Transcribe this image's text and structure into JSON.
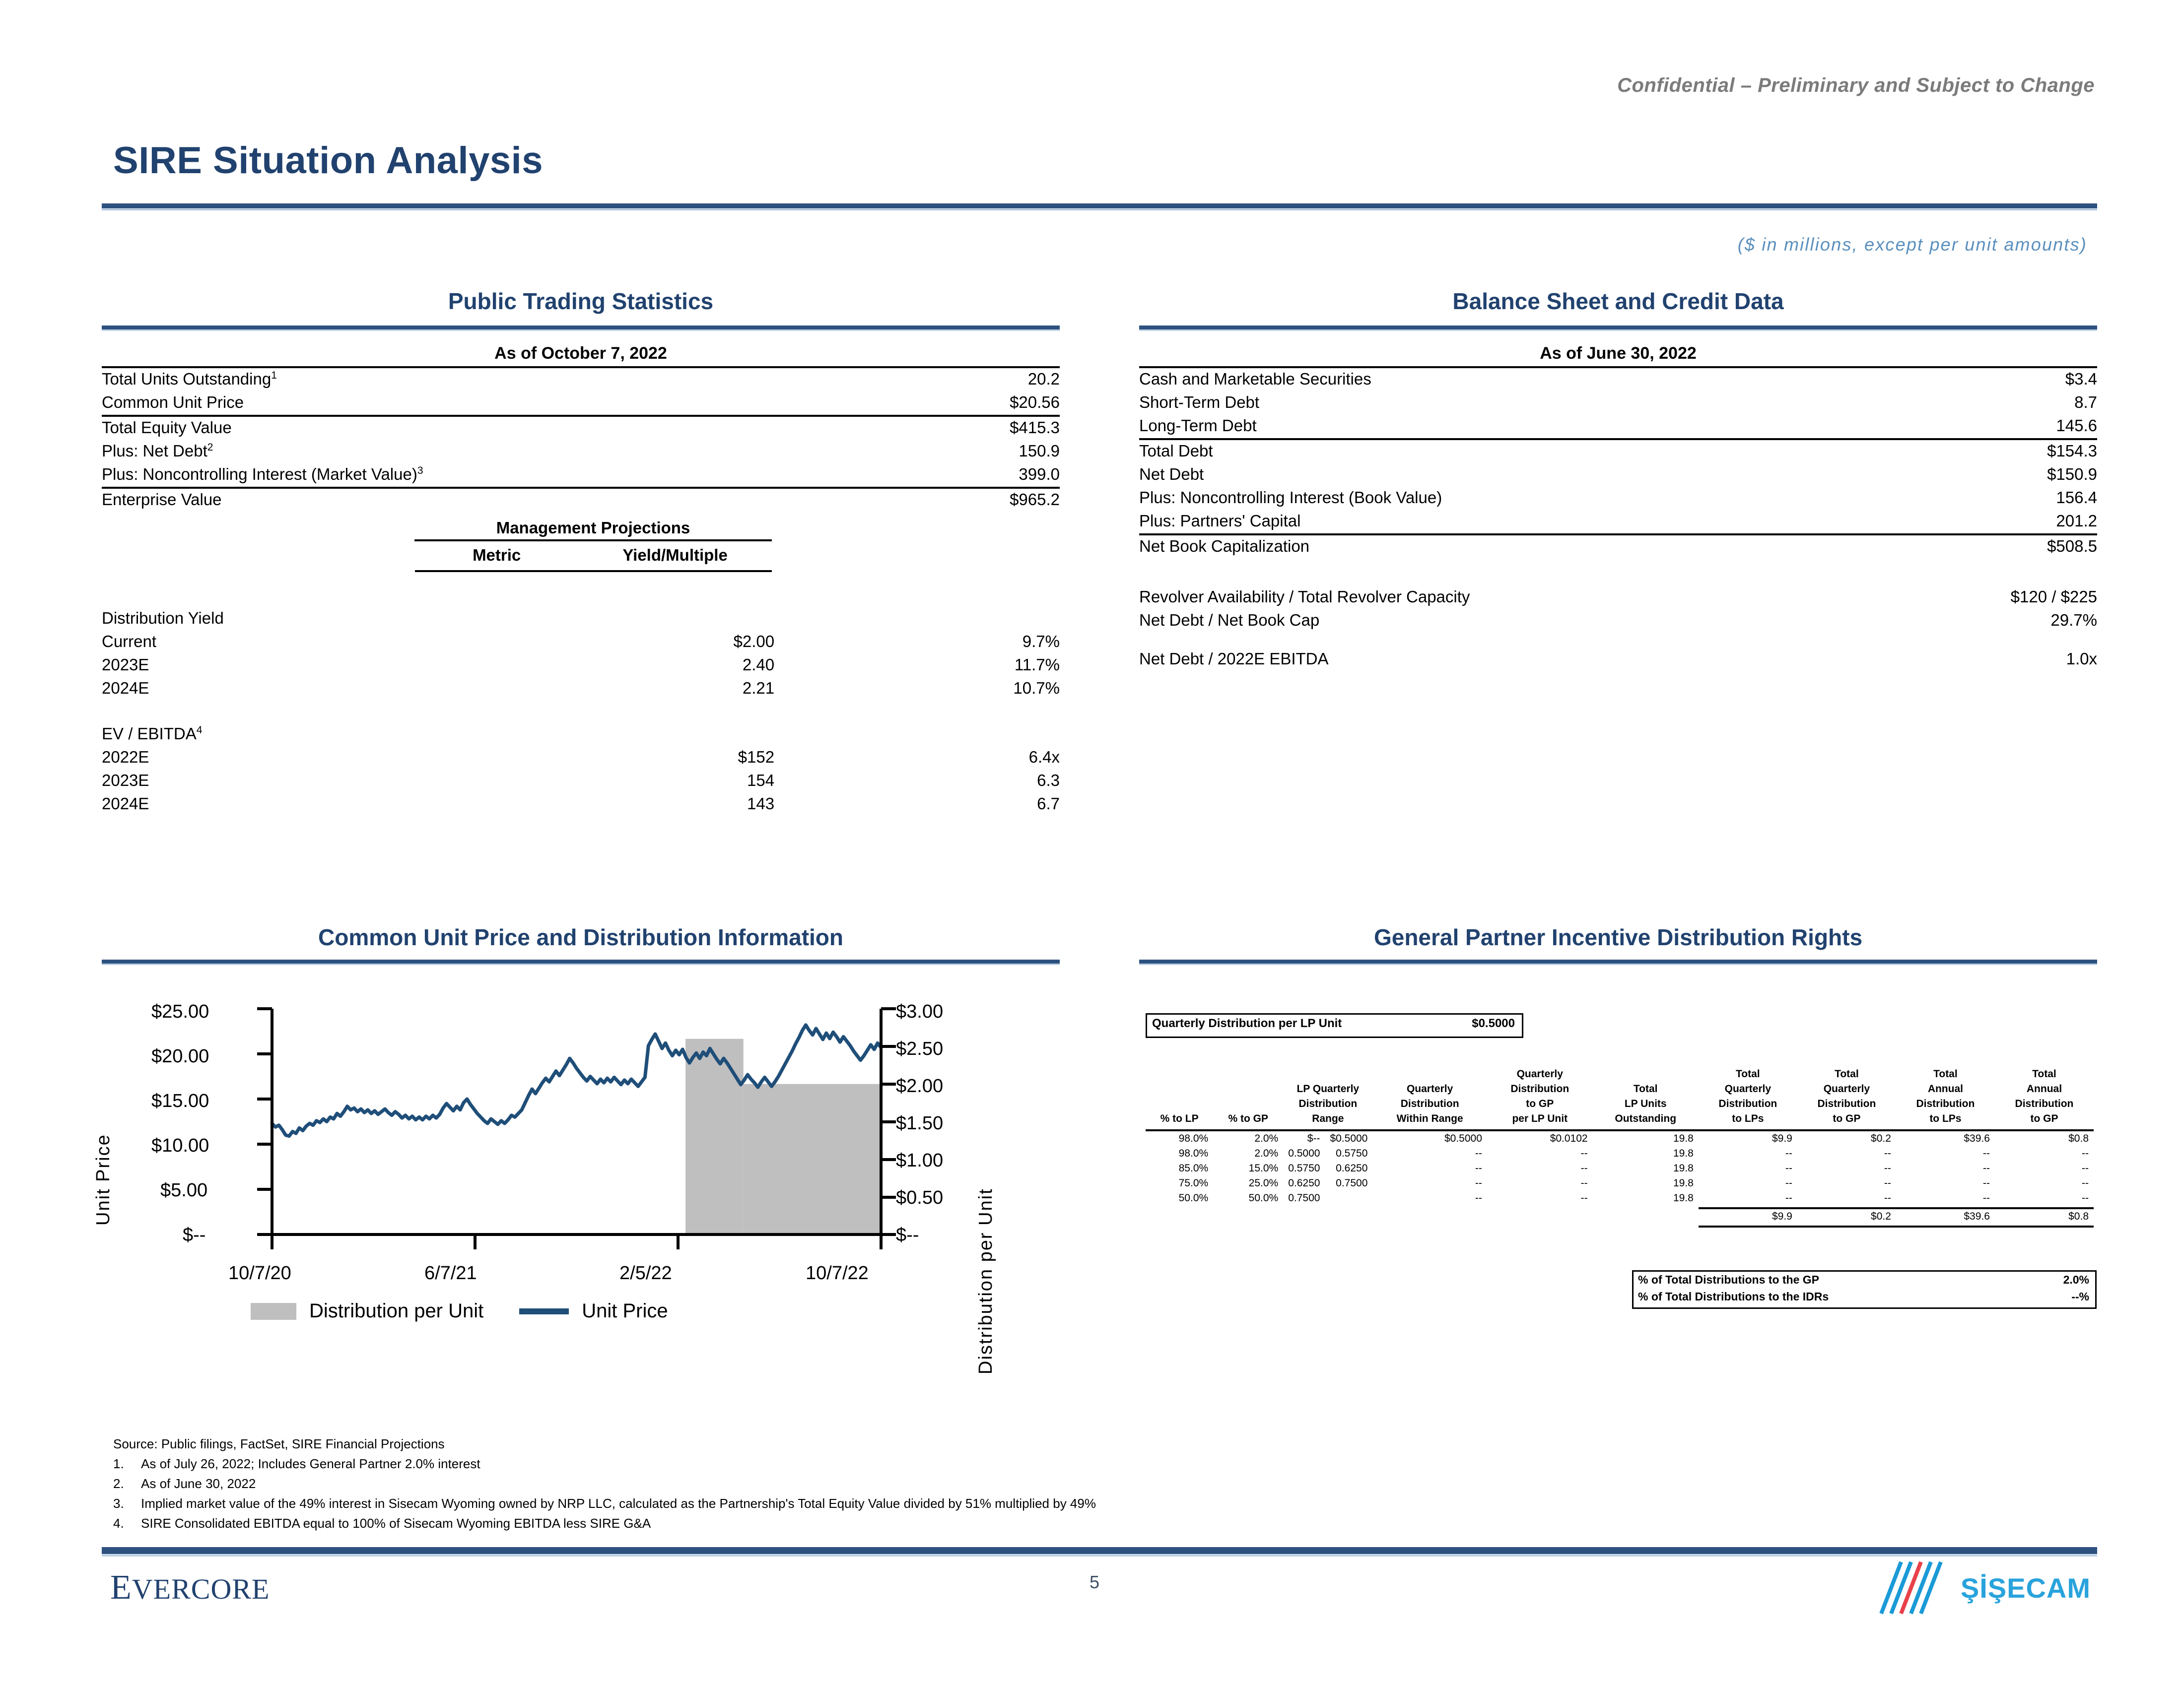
{
  "header": {
    "confidential": "Confidential – Preliminary and Subject to Change",
    "title": "SIRE Situation Analysis",
    "units_note": "($ in millions, except per unit amounts)"
  },
  "public_trading": {
    "heading": "Public Trading Statistics",
    "as_of": "As of October 7, 2022",
    "rows": [
      {
        "label": "Total Units Outstanding",
        "sup": "1",
        "value": "20.2"
      },
      {
        "label": "Common Unit Price",
        "sup": "",
        "value": "$20.56"
      },
      {
        "label": "Total Equity Value",
        "sup": "",
        "value": "$415.3"
      },
      {
        "label": "Plus: Net Debt",
        "sup": "2",
        "value": "150.9"
      },
      {
        "label": "Plus: Noncontrolling Interest (Market Value)",
        "sup": "3",
        "value": "399.0"
      },
      {
        "label": "Enterprise Value",
        "sup": "",
        "value": "$965.2"
      }
    ],
    "projections": {
      "title": "Management Projections",
      "col_metric": "Metric",
      "col_yield": "Yield/Multiple",
      "groups": [
        {
          "name": "Distribution Yield",
          "sup": "",
          "rows": [
            {
              "label": "Current",
              "metric": "$2.00",
              "yield": "9.7%"
            },
            {
              "label": "2023E",
              "metric": "2.40",
              "yield": "11.7%"
            },
            {
              "label": "2024E",
              "metric": "2.21",
              "yield": "10.7%"
            }
          ]
        },
        {
          "name": "EV / EBITDA",
          "sup": "4",
          "rows": [
            {
              "label": "2022E",
              "metric": "$152",
              "yield": "6.4x"
            },
            {
              "label": "2023E",
              "metric": "154",
              "yield": "6.3"
            },
            {
              "label": "2024E",
              "metric": "143",
              "yield": "6.7"
            }
          ]
        }
      ]
    }
  },
  "balance_sheet": {
    "heading": "Balance Sheet and Credit Data",
    "as_of": "As of June 30, 2022",
    "rows": [
      {
        "label": "Cash and Marketable Securities",
        "value": "$3.4"
      },
      {
        "label": "Short-Term Debt",
        "value": "8.7"
      },
      {
        "label": "Long-Term Debt",
        "value": "145.6"
      },
      {
        "label": "Total Debt",
        "value": "$154.3"
      },
      {
        "label": "Net Debt",
        "value": "$150.9"
      },
      {
        "label": "Plus: Noncontrolling Interest (Book Value)",
        "value": "156.4"
      },
      {
        "label": "Plus: Partners' Capital",
        "value": "201.2"
      },
      {
        "label": "Net Book Capitalization",
        "value": "$508.5"
      }
    ],
    "ratios": [
      {
        "label": "Revolver Availability / Total Revolver Capacity",
        "value": "$120 / $225"
      },
      {
        "label": "Net Debt / Net Book Cap",
        "value": "29.7%"
      },
      {
        "label": "Net Debt / 2022E EBITDA",
        "value": "1.0x"
      }
    ]
  },
  "price_chart": {
    "heading": "Common Unit Price and Distribution Information",
    "legend": [
      {
        "label": "Distribution per Unit",
        "color": "#bfbfbf",
        "marker": "bar"
      },
      {
        "label": "Unit Price",
        "color": "#1f4e79",
        "marker": "line"
      }
    ]
  },
  "chart_data": {
    "type": "line",
    "title": "Common Unit Price and Distribution Information",
    "xlabel": "",
    "ylabel": "Unit Price",
    "y2label": "Distribution per Unit",
    "x_ticks": [
      "10/7/20",
      "6/7/21",
      "2/5/22",
      "10/7/22"
    ],
    "y_ticks": [
      "$--",
      "$5.00",
      "$10.00",
      "$15.00",
      "$20.00",
      "$25.00"
    ],
    "ylim": [
      0,
      25
    ],
    "y2_ticks": [
      "$--",
      "$0.50",
      "$1.00",
      "$1.50",
      "$2.00",
      "$2.50",
      "$3.00"
    ],
    "y2lim": [
      0,
      3
    ],
    "grid": false,
    "legend_position": "bottom",
    "series": [
      {
        "name": "Unit Price",
        "type": "line",
        "color": "#1f4e79",
        "values": [
          12.3,
          11.9,
          12.1,
          11.6,
          11.0,
          10.9,
          11.4,
          11.2,
          11.8,
          11.5,
          12.0,
          12.3,
          12.1,
          12.6,
          12.4,
          12.8,
          12.5,
          13.0,
          12.8,
          13.4,
          13.1,
          13.6,
          14.2,
          13.8,
          14.0,
          13.6,
          13.9,
          13.5,
          13.8,
          13.4,
          13.7,
          13.3,
          13.6,
          13.9,
          13.5,
          13.2,
          13.6,
          13.3,
          12.9,
          13.2,
          12.8,
          13.1,
          12.7,
          13.0,
          12.7,
          13.1,
          12.8,
          13.2,
          12.9,
          13.3,
          14.0,
          14.5,
          14.1,
          13.7,
          14.2,
          13.8,
          14.6,
          15.0,
          14.4,
          13.9,
          13.4,
          13.0,
          12.6,
          12.3,
          12.8,
          12.5,
          12.2,
          12.6,
          12.3,
          12.7,
          13.2,
          13.0,
          13.4,
          13.8,
          14.6,
          15.4,
          16.1,
          15.6,
          16.2,
          16.8,
          17.3,
          16.9,
          17.5,
          18.1,
          17.6,
          18.2,
          18.8,
          19.5,
          19.0,
          18.4,
          17.9,
          17.4,
          17.0,
          17.5,
          17.1,
          16.7,
          17.2,
          16.8,
          17.3,
          16.9,
          17.4,
          17.0,
          16.6,
          17.1,
          16.7,
          17.2,
          16.8,
          16.4,
          16.9,
          17.4,
          20.9,
          21.6,
          22.2,
          21.4,
          20.6,
          21.2,
          20.4,
          19.8,
          20.4,
          19.9,
          20.5,
          19.6,
          19.0,
          19.6,
          20.1,
          19.5,
          20.2,
          19.8,
          20.6,
          20.0,
          19.4,
          18.9,
          19.5,
          19.0,
          18.4,
          17.8,
          17.2,
          16.6,
          17.1,
          17.7,
          17.2,
          16.8,
          16.3,
          16.9,
          17.4,
          16.9,
          16.4,
          16.9,
          17.5,
          18.2,
          18.9,
          19.6,
          20.3,
          21.1,
          21.8,
          22.6,
          23.2,
          22.6,
          22.1,
          22.8,
          22.2,
          21.6,
          22.3,
          21.7,
          22.4,
          21.9,
          21.3,
          21.9,
          21.4,
          20.9,
          20.3,
          19.8,
          19.3,
          19.8,
          20.4,
          21.0,
          20.5,
          21.2,
          20.7
        ]
      },
      {
        "name": "Distribution per Unit",
        "type": "bar",
        "color": "#bfbfbf",
        "bars": [
          {
            "start_frac": 0.679,
            "end_frac": 0.774,
            "value": 2.6
          },
          {
            "start_frac": 0.774,
            "end_frac": 1.0,
            "value": 2.0
          }
        ]
      }
    ]
  },
  "idr": {
    "heading": "General Partner Incentive Distribution Rights",
    "quarterly_box": {
      "label": "Quarterly Distribution per LP Unit",
      "value": "$0.5000"
    },
    "columns": [
      [
        "",
        "",
        "% to LP"
      ],
      [
        "",
        "",
        "% to GP"
      ],
      [
        "",
        "LP Quarterly",
        "Distribution"
      ],
      [
        "",
        "",
        "Range"
      ],
      [
        "",
        "Quarterly",
        "Distribution"
      ],
      [
        "Quarterly",
        "Distribution",
        "to GP"
      ],
      [
        "",
        "Total",
        "LP Units"
      ],
      [
        "Total",
        "Quarterly",
        "Distribution"
      ],
      [
        "Total",
        "Quarterly",
        "Distribution"
      ],
      [
        "Total",
        "Annual",
        "Distribution"
      ],
      [
        "Total",
        "Annual",
        "Distribution"
      ]
    ],
    "col_headers": [
      {
        "l1": "",
        "l2": "",
        "l3": "% to LP"
      },
      {
        "l1": "",
        "l2": "",
        "l3": "% to GP"
      },
      {
        "l1": "",
        "l2": "LP Quarterly",
        "l3": "Distribution",
        "l4": "Range"
      },
      {
        "l1": "",
        "l2": "Quarterly",
        "l3": "Distribution",
        "l4": "Within Range"
      },
      {
        "l1": "Quarterly",
        "l2": "Distribution",
        "l3": "to GP",
        "l4": "per LP Unit"
      },
      {
        "l1": "",
        "l2": "Total",
        "l3": "LP Units",
        "l4": "Outstanding"
      },
      {
        "l1": "Total",
        "l2": "Quarterly",
        "l3": "Distribution",
        "l4": "to LPs"
      },
      {
        "l1": "Total",
        "l2": "Quarterly",
        "l3": "Distribution",
        "l4": "to GP"
      },
      {
        "l1": "Total",
        "l2": "Annual",
        "l3": "Distribution",
        "l4": "to LPs"
      },
      {
        "l1": "Total",
        "l2": "Annual",
        "l3": "Distribution",
        "l4": "to GP"
      }
    ],
    "rows": [
      {
        "to_lp": "98.0%",
        "to_gp": "2.0%",
        "range_lo": "$--",
        "range_hi": "$0.5000",
        "within": "$0.5000",
        "gp_per_unit": "$0.0102",
        "lp_units": "19.8",
        "q_lp": "$9.9",
        "q_gp": "$0.2",
        "a_lp": "$39.6",
        "a_gp": "$0.8"
      },
      {
        "to_lp": "98.0%",
        "to_gp": "2.0%",
        "range_lo": "0.5000",
        "range_hi": "0.5750",
        "within": "--",
        "gp_per_unit": "--",
        "lp_units": "19.8",
        "q_lp": "--",
        "q_gp": "--",
        "a_lp": "--",
        "a_gp": "--"
      },
      {
        "to_lp": "85.0%",
        "to_gp": "15.0%",
        "range_lo": "0.5750",
        "range_hi": "0.6250",
        "within": "--",
        "gp_per_unit": "--",
        "lp_units": "19.8",
        "q_lp": "--",
        "q_gp": "--",
        "a_lp": "--",
        "a_gp": "--"
      },
      {
        "to_lp": "75.0%",
        "to_gp": "25.0%",
        "range_lo": "0.6250",
        "range_hi": "0.7500",
        "within": "--",
        "gp_per_unit": "--",
        "lp_units": "19.8",
        "q_lp": "--",
        "q_gp": "--",
        "a_lp": "--",
        "a_gp": "--"
      },
      {
        "to_lp": "50.0%",
        "to_gp": "50.0%",
        "range_lo": "0.7500",
        "range_hi": "",
        "within": "--",
        "gp_per_unit": "--",
        "lp_units": "19.8",
        "q_lp": "--",
        "q_gp": "--",
        "a_lp": "--",
        "a_gp": "--"
      }
    ],
    "totals": {
      "q_lp": "$9.9",
      "q_gp": "$0.2",
      "a_lp": "$39.6",
      "a_gp": "$0.8"
    },
    "summary": [
      {
        "label": "% of Total Distributions to the GP",
        "value": "2.0%"
      },
      {
        "label": "% of Total Distributions to the IDRs",
        "value": "--%"
      }
    ]
  },
  "footnotes": {
    "source": "Source: Public filings, FactSet, SIRE Financial Projections",
    "items": [
      {
        "num": "1.",
        "text": "As of July 26, 2022; Includes General Partner 2.0% interest"
      },
      {
        "num": "2.",
        "text": "As of June 30, 2022"
      },
      {
        "num": "3.",
        "text": "Implied market value of the 49% interest in Sisecam Wyoming owned by NRP LLC, calculated as the Partnership's Total Equity Value divided by 51% multiplied by 49%"
      },
      {
        "num": "4.",
        "text": "SIRE Consolidated EBITDA equal to 100% of Sisecam Wyoming EBITDA less SIRE G&A"
      }
    ]
  },
  "footer": {
    "bank_logo_first": "E",
    "bank_logo_rest": "VERCORE",
    "page_number": "5",
    "client_logo": "ŞİŞECAM"
  }
}
